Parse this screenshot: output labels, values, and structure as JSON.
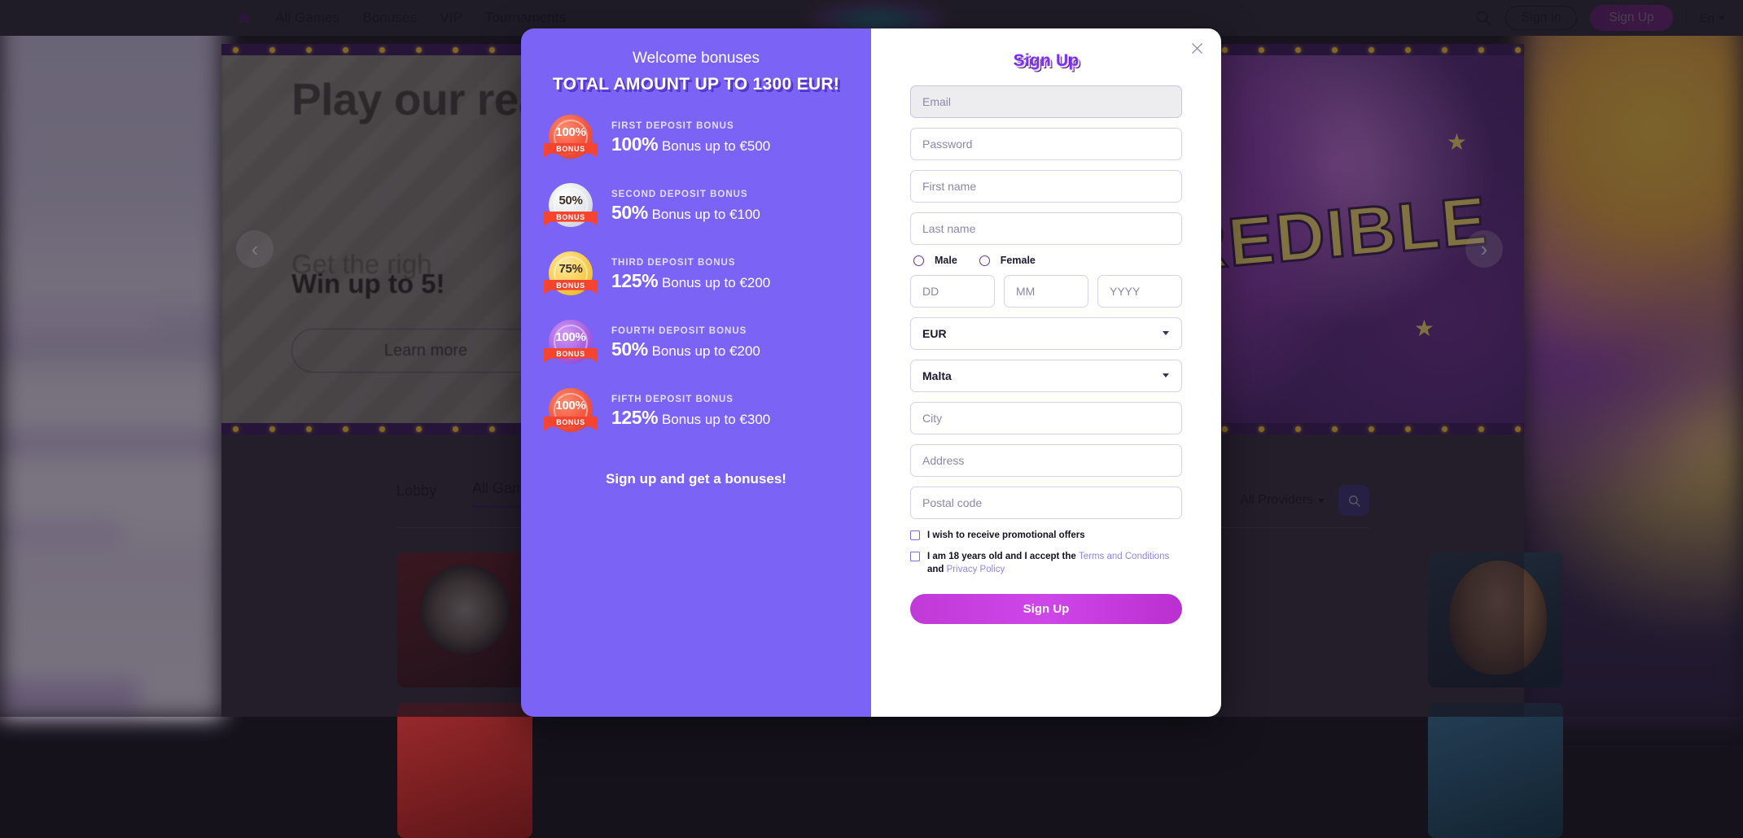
{
  "header": {
    "home_icon": "home-icon",
    "nav": [
      {
        "label": "All Games"
      },
      {
        "label": "Bonuses"
      },
      {
        "label": "VIP"
      },
      {
        "label": "Tournaments"
      }
    ],
    "search_icon": "search-icon",
    "sign_in": "Sign In",
    "sign_up": "Sign Up",
    "language": "En"
  },
  "banner": {
    "headline": "Play our real pr big pri casino",
    "sub1": "Get the righ",
    "sub2": "Win up to 5!",
    "learn_more": "Learn more",
    "prev_icon": "chevron-left-icon",
    "next_icon": "chevron-right-icon",
    "art_word": "INCREDIBLE"
  },
  "games": {
    "tabs": [
      {
        "label": "Lobby",
        "active": false
      },
      {
        "label": "All Games",
        "active": true
      }
    ],
    "providers_label": "All Providers",
    "provider_search_icon": "search-icon"
  },
  "modal": {
    "close_icon": "close-icon",
    "bonuses": {
      "title": "Welcome bonuses",
      "total": "TOTAL AMOUNT UP TO 1300 EUR!",
      "cta": "Sign up and get a bonuses!",
      "items": [
        {
          "badge_pct": "100%",
          "badge_ribbon": "BONUS",
          "badge_color": "red",
          "label": "FIRST DEPOSIT BONUS",
          "amount": "100%",
          "desc": "Bonus up to €500"
        },
        {
          "badge_pct": "50%",
          "badge_ribbon": "BONUS",
          "badge_color": "silver",
          "label": "SECOND DEPOSIT BONUS",
          "amount": "50%",
          "desc": "Bonus up to €100"
        },
        {
          "badge_pct": "75%",
          "badge_ribbon": "BONUS",
          "badge_color": "gold",
          "label": "THIRD DEPOSIT BONUS",
          "amount": "125%",
          "desc": "Bonus up to €200"
        },
        {
          "badge_pct": "100%",
          "badge_ribbon": "BONUS",
          "badge_color": "purple",
          "label": "FOURTH DEPOSIT BONUS",
          "amount": "50%",
          "desc": "Bonus up to €200"
        },
        {
          "badge_pct": "100%",
          "badge_ribbon": "BONUS",
          "badge_color": "red",
          "label": "FIFTH DEPOSIT BONUS",
          "amount": "125%",
          "desc": "Bonus up to €300"
        }
      ]
    },
    "form": {
      "title": "Sign Up",
      "email_placeholder": "Email",
      "email_value": "",
      "password_placeholder": "Password",
      "first_name_placeholder": "First name",
      "last_name_placeholder": "Last name",
      "gender_male": "Male",
      "gender_female": "Female",
      "dd_placeholder": "DD",
      "mm_placeholder": "MM",
      "yyyy_placeholder": "YYYY",
      "currency_value": "EUR",
      "country_value": "Malta",
      "city_placeholder": "City",
      "address_placeholder": "Address",
      "postal_placeholder": "Postal code",
      "promo_checkbox_label": "I wish to receive promotional offers",
      "terms_prefix": "I am 18 years old and I accept the ",
      "terms_link": "Terms and Conditions",
      "terms_and": " and ",
      "privacy_link": "Privacy Policy",
      "submit_label": "Sign Up"
    }
  },
  "colors": {
    "bonus_panel": "#7a63f5",
    "accent_purple": "#7b2ff7",
    "submit_gradient_start": "#c03ad8",
    "header_signup": "#8e1f9e"
  }
}
